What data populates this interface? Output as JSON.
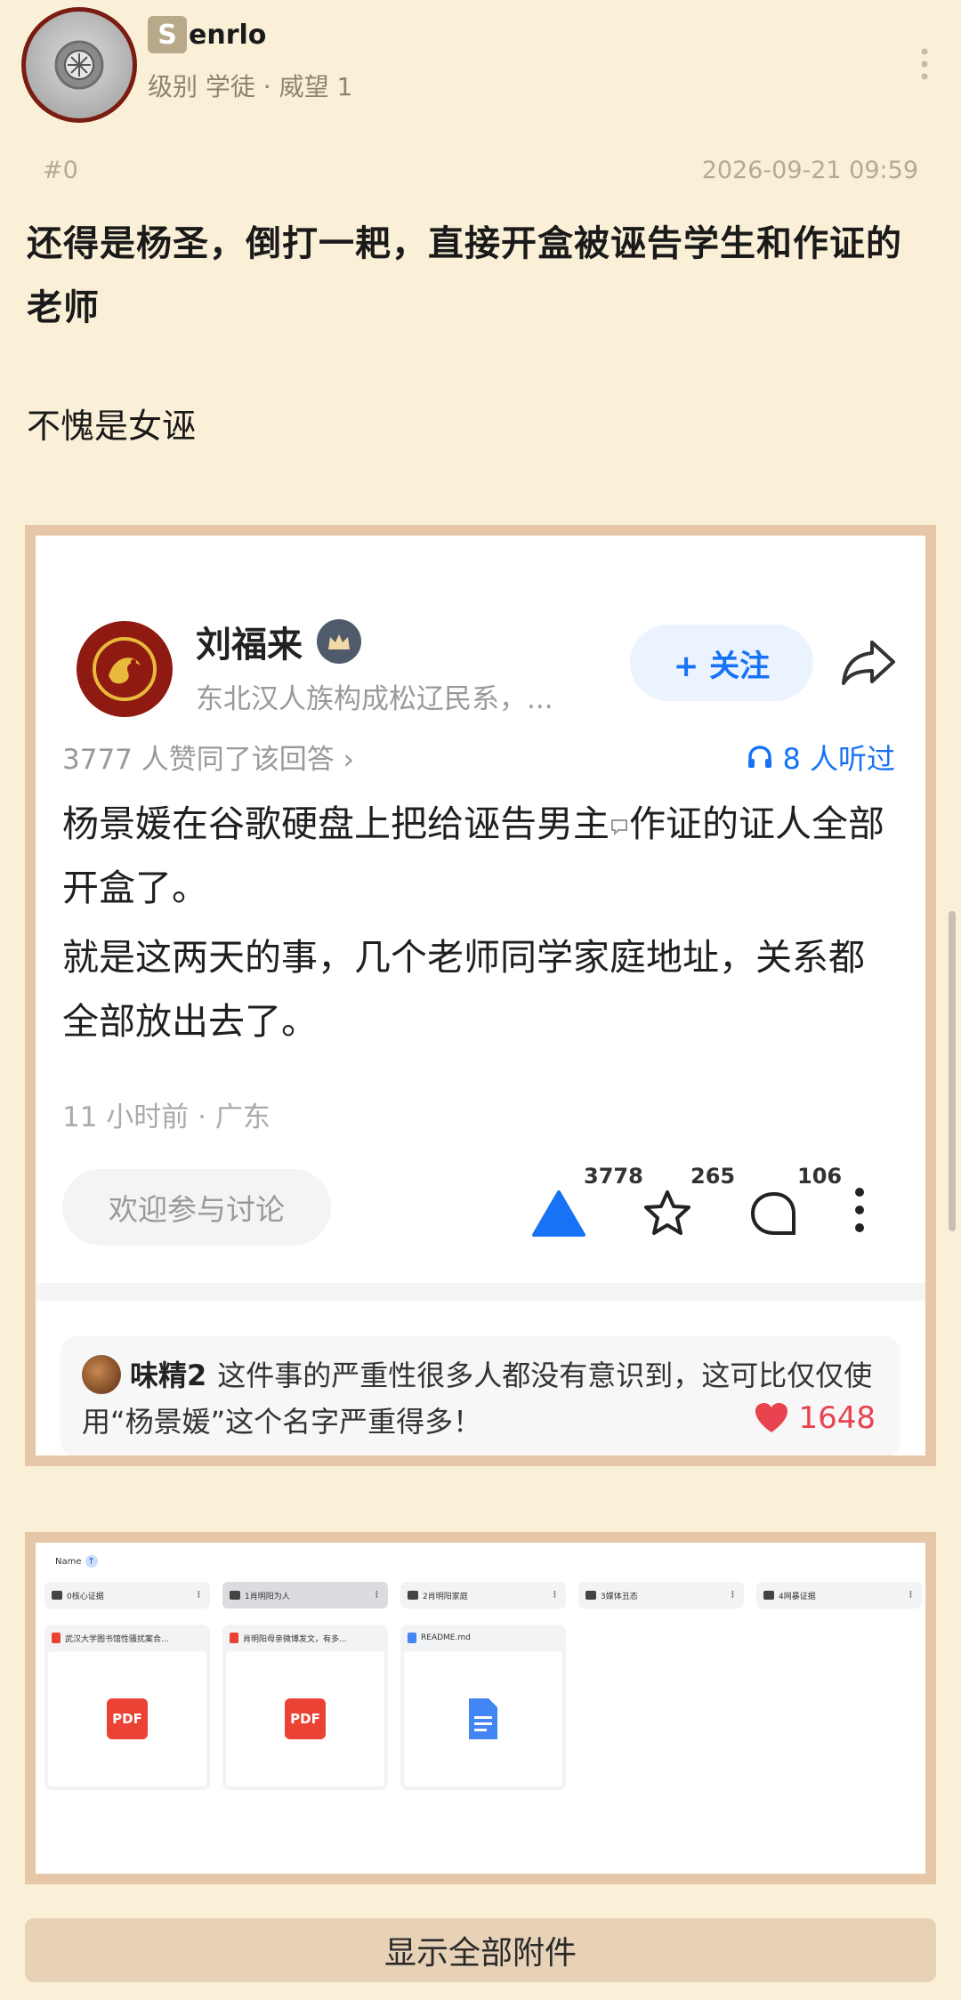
{
  "header": {
    "username_initial": "S",
    "username_rest": "enrlo",
    "user_meta": "级别 学徒 · 威望 1",
    "floor": "#0",
    "timestamp": "2026-09-21 09:59"
  },
  "post": {
    "title": "还得是杨圣，倒打一耙，直接开盒被诬告学生和作证的老师",
    "body": "不愧是女诬"
  },
  "screenshot": {
    "author_name": "刘福来",
    "author_bio": "东北汉人族构成松辽民系，...",
    "follow_label": "+ 关注",
    "agree_text": "3777 人赞同了该回答 ›",
    "listen_text": "8 人听过",
    "paragraph1": "杨景媛在谷歌硬盘上把给诬告男主",
    "paragraph1_end": "作证的证人全部开盒了。",
    "paragraph2": "就是这两天的事，几个老师同学家庭地址，关系都全部放出去了。",
    "answer_meta": "11 小时前 · 广东",
    "comment_placeholder": "欢迎参与讨论",
    "upvotes": "3778",
    "favorites": "265",
    "comments": "106",
    "hot_comment": {
      "name": "味精2",
      "text": "这件事的严重性很多人都没有意识到，这可比仅仅使用“杨景媛”这个名字严重得多！",
      "likes": "1648"
    }
  },
  "files": {
    "header": "Name",
    "folders": [
      "0核心证据",
      "1肖明阳为人",
      "2肖明阳家庭",
      "3媒体丑态",
      "4网暴证据"
    ],
    "cards": [
      {
        "title": "武汉大学图书馆性骚扰案合...",
        "type": "pdf",
        "badge": "PDF"
      },
      {
        "title": "肖明阳母亲微博发文，有多...",
        "type": "pdf",
        "badge": "PDF"
      },
      {
        "title": "README.md",
        "type": "doc",
        "badge": ""
      }
    ]
  },
  "show_all_label": "显示全部附件",
  "colors": {
    "page_bg": "#faf0d8",
    "zhihu_blue": "#1772f6",
    "like_red": "#e8434f",
    "frame": "#e6c8a8"
  }
}
